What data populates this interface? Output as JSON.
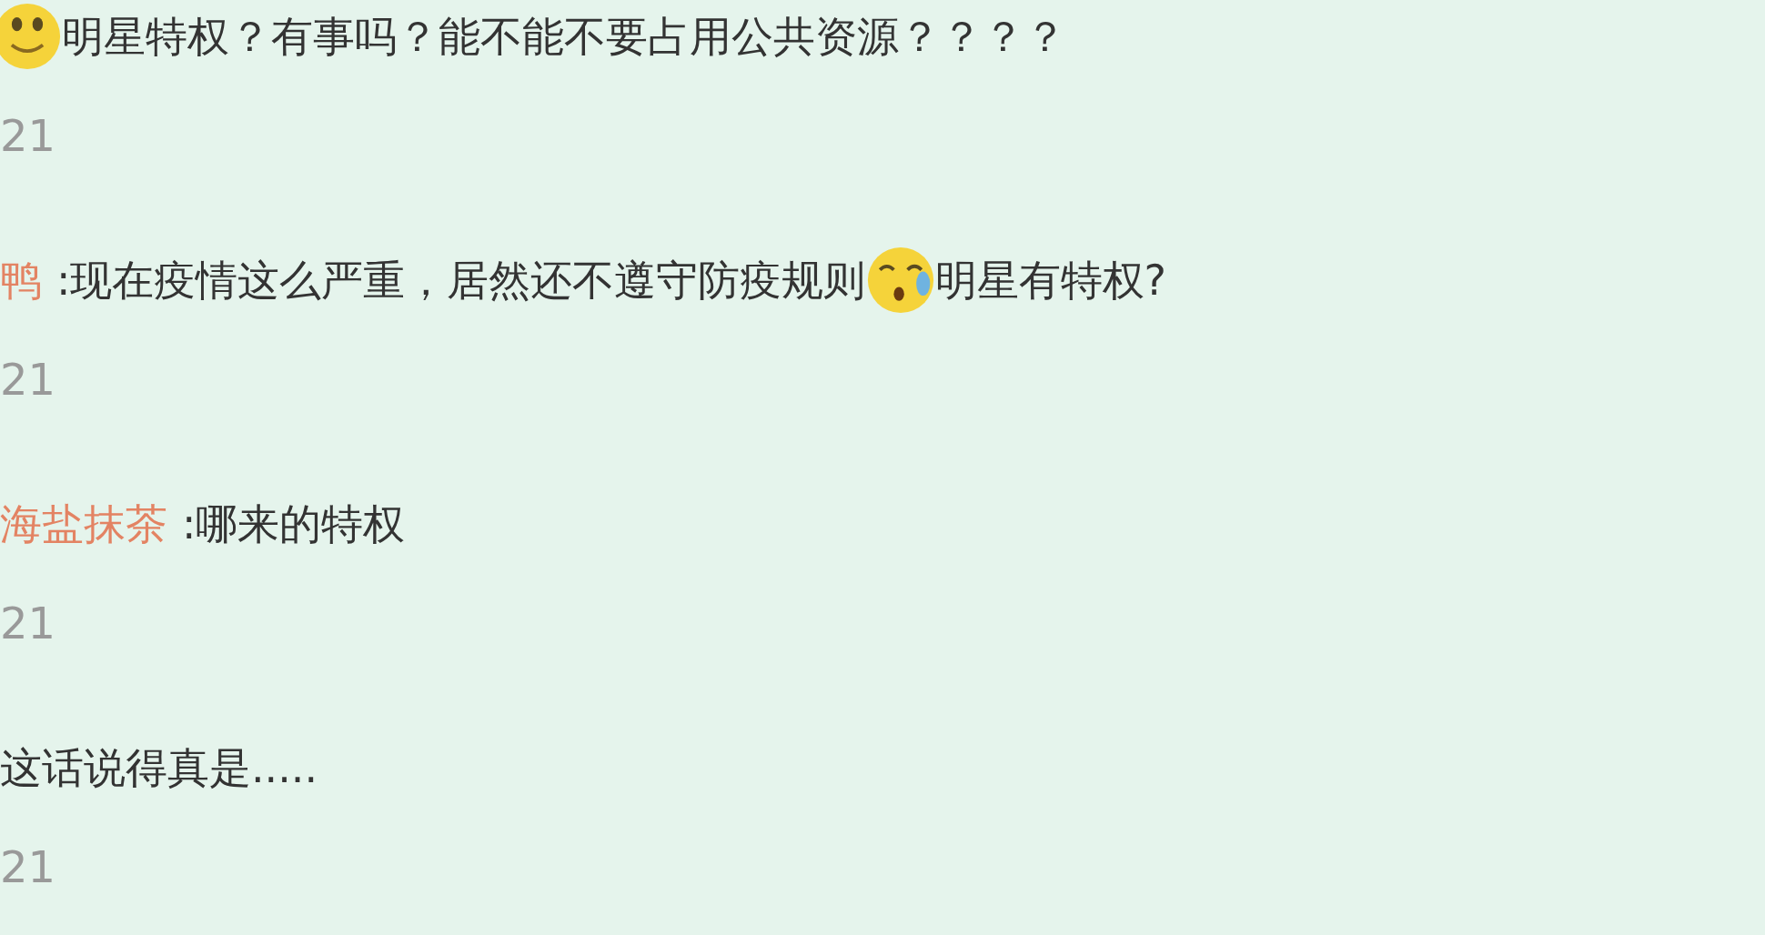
{
  "comments": [
    {
      "segments": [
        {
          "kind": "smile-emoji"
        },
        {
          "kind": "text",
          "text": "明星特权？有事吗？能不能不要占用公共资源？？？？"
        }
      ],
      "time": "21"
    },
    {
      "user": "鸭",
      "segments": [
        {
          "kind": "text",
          "text": ":现在疫情这么严重，居然还不遵守防疫规则"
        },
        {
          "kind": "tear-emoji"
        },
        {
          "kind": "text",
          "text": "明星有特权?"
        }
      ],
      "time": "21"
    },
    {
      "user": "海盐抹茶",
      "segments": [
        {
          "kind": "text",
          "text": ":哪来的特权"
        }
      ],
      "time": "21"
    },
    {
      "segments": [
        {
          "kind": "text",
          "text": "这话说得真是....."
        }
      ],
      "time": "21"
    }
  ]
}
